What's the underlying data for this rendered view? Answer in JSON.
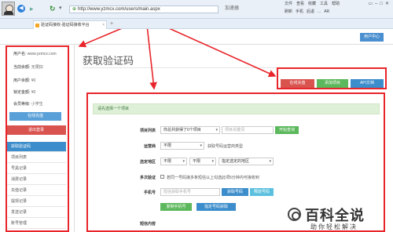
{
  "browser": {
    "address": "http://www.yzmcx.com/users/main.aspx",
    "tools_label": "加速器",
    "menu": [
      "文件",
      "查看",
      "收藏",
      "工具",
      "帮助"
    ],
    "toolbar_icons": [
      "刷新",
      "手机",
      "后退",
      "...",
      "AR"
    ],
    "tab_title": "验证码接收-验证码接收平台",
    "new_tab": "+"
  },
  "header": {
    "user_center_label": "用户中心"
  },
  "sidebar": {
    "info": [
      {
        "key": "用户名:",
        "value": "www.yzmcx.com"
      },
      {
        "key": "当前余额:",
        "value": "无限扣"
      },
      {
        "key": "用户余额:",
        "value": "¥0"
      },
      {
        "key": "锁定金额:",
        "value": "¥0"
      },
      {
        "key": "会员等级:",
        "value": "小学生"
      }
    ],
    "top_up_label": "在线充值",
    "logout_label": "退出登录",
    "menu": [
      "获取验证码",
      "项目列表",
      "号黑记录",
      "消费记录",
      "充值记录",
      "提现记录",
      "发送记录",
      "账号管理"
    ]
  },
  "main": {
    "title": "获取验证码",
    "actions": {
      "online_topup": "在线充值",
      "add_project": "添加项目",
      "api_docs": "API文档"
    },
    "notice": "请先选择一个项目",
    "form": {
      "project_label": "项目列表",
      "project_select": "你总共获得了0个项目",
      "project_search_placeholder": "项目关键词",
      "start_query": "开始查询",
      "operator_label": "运营商",
      "operator_select": "不限",
      "operator_hint": "获取号码运营商类型",
      "region_label": "选定地区",
      "region_select_1": "不限",
      "region_select_2": "不限",
      "region_hint": "指定选定的地区",
      "multi_label": "多次验证",
      "multi_hint": "若同一号码接多条短信以上勾选此项5分钟内可接收到",
      "phone_label": "手机号",
      "phone_placeholder": "短信获取手机号",
      "get_number": "获取号码",
      "release_number": "释放号码",
      "copy_number": "复制手机号",
      "specify_number": "指定号码获取",
      "sms_label": "短信内容"
    }
  },
  "watermark": {
    "big": "百科全说",
    "small": "助你轻松解决"
  },
  "colors": {
    "accent": "#3c8dcb",
    "danger": "#d9534f",
    "success": "#5cb85c",
    "annotation": "#e8252a"
  }
}
